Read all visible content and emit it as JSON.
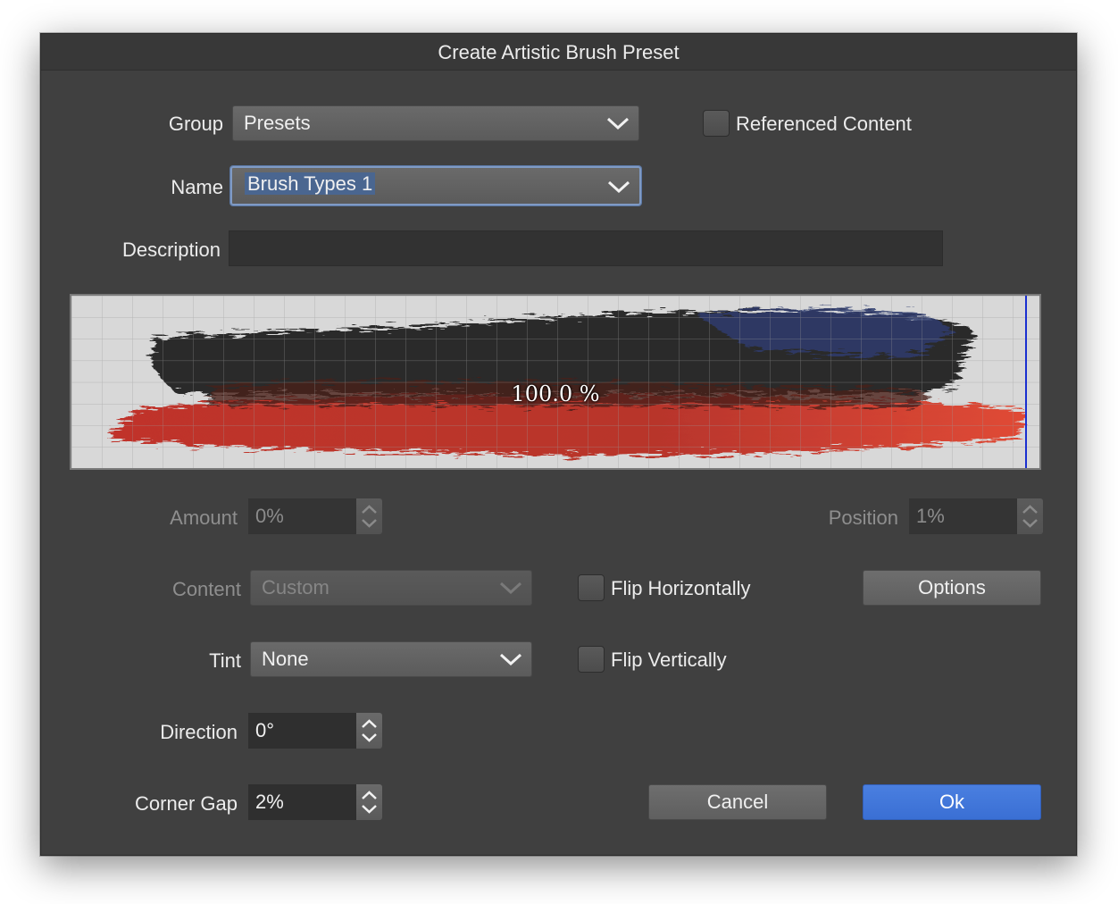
{
  "dialog": {
    "title": "Create Artistic Brush Preset"
  },
  "group": {
    "label": "Group",
    "value": "Presets"
  },
  "referenced_content": {
    "label": "Referenced Content",
    "checked": false
  },
  "name": {
    "label": "Name",
    "value": "Brush Types 1"
  },
  "description": {
    "label": "Description",
    "value": ""
  },
  "preview": {
    "label": "100.0 %",
    "colors": {
      "dark": "#262626",
      "red": "#c8372c",
      "blue": "#2e3c6e",
      "grid": "#9a9a9a",
      "marker": "#1a2fd0"
    }
  },
  "amount": {
    "label": "Amount",
    "value": "0%"
  },
  "position": {
    "label": "Position",
    "value": "1%"
  },
  "content": {
    "label": "Content",
    "value": "Custom"
  },
  "flip_horizontally": {
    "label": "Flip Horizontally",
    "checked": false
  },
  "options_button": {
    "label": "Options"
  },
  "tint": {
    "label": "Tint",
    "value": "None"
  },
  "flip_vertically": {
    "label": "Flip Vertically",
    "checked": false
  },
  "direction": {
    "label": "Direction",
    "value": "0°"
  },
  "corner_gap": {
    "label": "Corner Gap",
    "value": "2%"
  },
  "cancel_button": {
    "label": "Cancel"
  },
  "ok_button": {
    "label": "Ok"
  },
  "accent_color": "#3a6fd4"
}
